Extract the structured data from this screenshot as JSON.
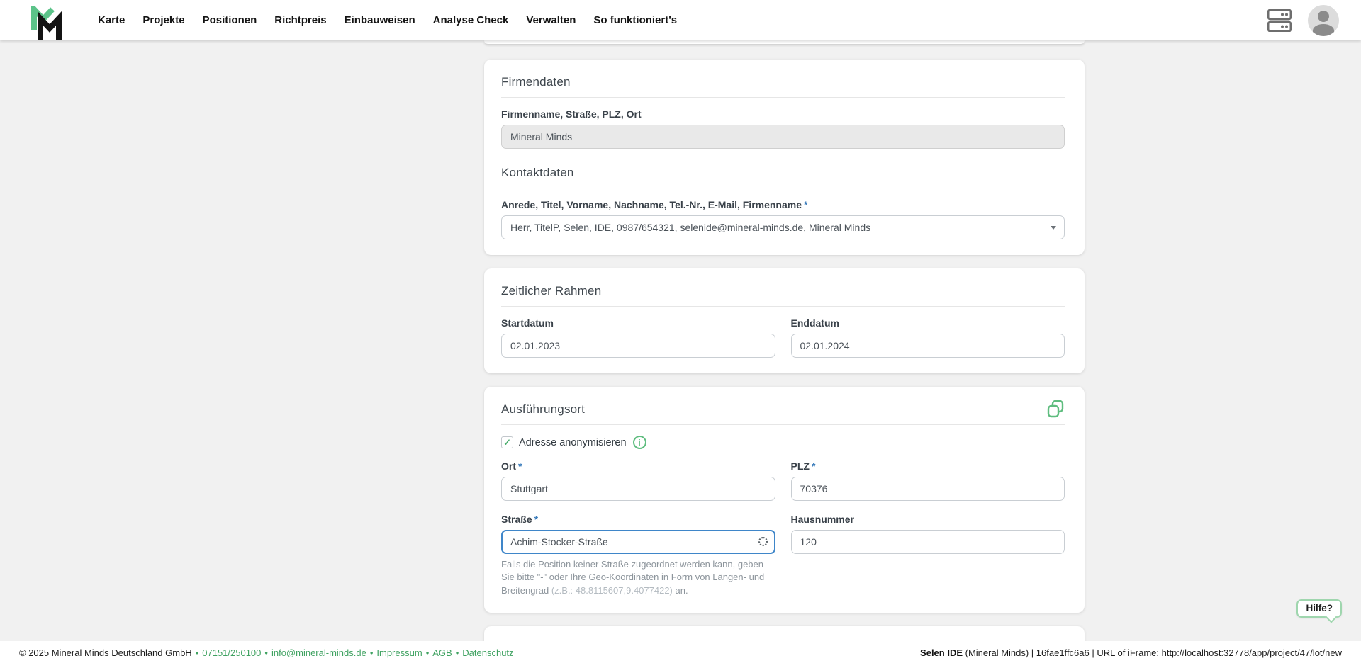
{
  "nav": {
    "items": [
      "Karte",
      "Projekte",
      "Positionen",
      "Richtpreis",
      "Einbauweisen",
      "Analyse Check",
      "Verwalten",
      "So funktioniert's"
    ]
  },
  "ui": {
    "required_marker": "*",
    "check_glyph": "✓",
    "info_glyph": "i",
    "help_label": "Hilfe?"
  },
  "firmendaten": {
    "title": "Firmendaten",
    "company_label": "Firmenname, Straße, PLZ, Ort",
    "company_value": "Mineral Minds",
    "contact_title": "Kontaktdaten",
    "contact_label": "Anrede, Titel, Vorname, Nachname, Tel.-Nr., E-Mail, Firmenname",
    "contact_value": "Herr, TitelP, Selen, IDE, 0987/654321, selenide@mineral-minds.de, Mineral Minds"
  },
  "zeitraum": {
    "title": "Zeitlicher Rahmen",
    "start_label": "Startdatum",
    "start_value": "02.01.2023",
    "end_label": "Enddatum",
    "end_value": "02.01.2024"
  },
  "ausfuehrungsort": {
    "title": "Ausführungsort",
    "anonymize_label": "Adresse anonymisieren",
    "ort_label": "Ort",
    "ort_value": "Stuttgart",
    "plz_label": "PLZ",
    "plz_value": "70376",
    "strasse_label": "Straße",
    "strasse_value": "Achim-Stocker-Straße",
    "hausnummer_label": "Hausnummer",
    "hausnummer_value": "120",
    "helper_text": "Falls die Position keiner Straße zugeordnet werden kann, geben Sie bitte \"-\" oder Ihre Geo-Koordinaten in Form von Längen- und Breitengrad ",
    "helper_example": "(z.B.: 48.8115607,9.4077422)",
    "helper_suffix": " an."
  },
  "footer": {
    "copyright": "© 2025 Mineral Minds Deutschland GmbH",
    "separator": "•",
    "links": [
      "07151/250100",
      "info@mineral-minds.de",
      "Impressum",
      "AGB",
      "Datenschutz"
    ],
    "right_bold": "Selen IDE",
    "right_rest": " (Mineral Minds) | 16fae1ffc6a6 | URL of iFrame: http://localhost:32778/app/project/47/lot/new"
  },
  "colors": {
    "accent_green": "#5cb57e",
    "logo_green": "#5bc389",
    "link_green": "#3fa261",
    "required_blue": "#3d7ebc",
    "focus_blue": "#3f86c9",
    "page_background": "#f1f1f1"
  }
}
